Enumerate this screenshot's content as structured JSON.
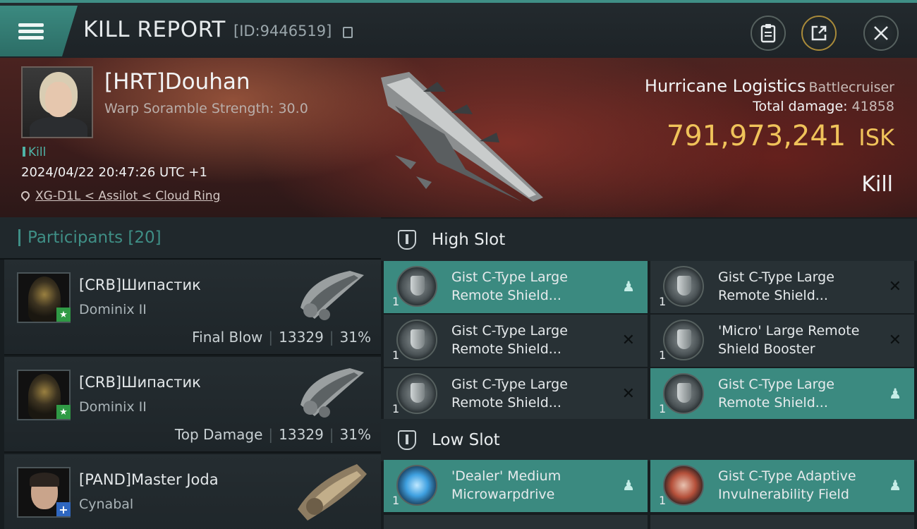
{
  "header": {
    "title": "KILL REPORT",
    "report_id": "[ID:9446519]"
  },
  "victim": {
    "name": "[HRT]Douhan",
    "scramble_text": "Warp Soramble Strength: 30.0",
    "type_tag": "Kill",
    "timestamp": "2024/04/22 20:47:26 UTC +1",
    "location": "XG-D1L < Assilot < Cloud Ring",
    "ship_name": "Hurricane Logistics",
    "ship_class": "Battlecruiser",
    "total_damage_label": "Total damage:",
    "total_damage": "41858",
    "isk_value": "791,973,241",
    "isk_unit": "ISK",
    "result": "Kill"
  },
  "participants": {
    "title": "Participants",
    "count": "[20]",
    "rows": [
      {
        "name": "[CRB]Шипастик",
        "ship": "Dominix II",
        "role": "Final Blow",
        "damage": "13329",
        "percent": "31%",
        "badge": "★"
      },
      {
        "name": "[CRB]Шипастик",
        "ship": "Dominix II",
        "role": "Top Damage",
        "damage": "13329",
        "percent": "31%",
        "badge": "★"
      },
      {
        "name": "[PAND]Master Joda",
        "ship": "Cynabal",
        "role": "",
        "damage": "",
        "percent": "",
        "badge": "+"
      }
    ]
  },
  "fittings": {
    "high_slot_title": "High Slot",
    "low_slot_title": "Low Slot",
    "high": [
      {
        "qty": "1",
        "name": "Gist C-Type Large Remote Shield...",
        "status": "dropped"
      },
      {
        "qty": "1",
        "name": "Gist C-Type Large Remote Shield...",
        "status": "destroyed"
      },
      {
        "qty": "1",
        "name": "Gist C-Type Large Remote Shield...",
        "status": "destroyed"
      },
      {
        "qty": "1",
        "name": "'Micro' Large Remote Shield Booster",
        "status": "destroyed"
      },
      {
        "qty": "1",
        "name": "Gist C-Type Large Remote Shield...",
        "status": "destroyed"
      },
      {
        "qty": "1",
        "name": "Gist C-Type Large Remote Shield...",
        "status": "dropped"
      }
    ],
    "low": [
      {
        "qty": "1",
        "name": "'Dealer' Medium Microwarpdrive",
        "status": "dropped"
      },
      {
        "qty": "1",
        "name": "Gist C-Type Adaptive Invulnerability Field",
        "status": "dropped"
      }
    ]
  },
  "colors": {
    "accent_teal": "#3b8a80",
    "isk_gold": "#f0c35a",
    "banner_red": "#4a2320"
  },
  "icons": {
    "dropped": "person-icon",
    "destroyed": "x-icon"
  }
}
